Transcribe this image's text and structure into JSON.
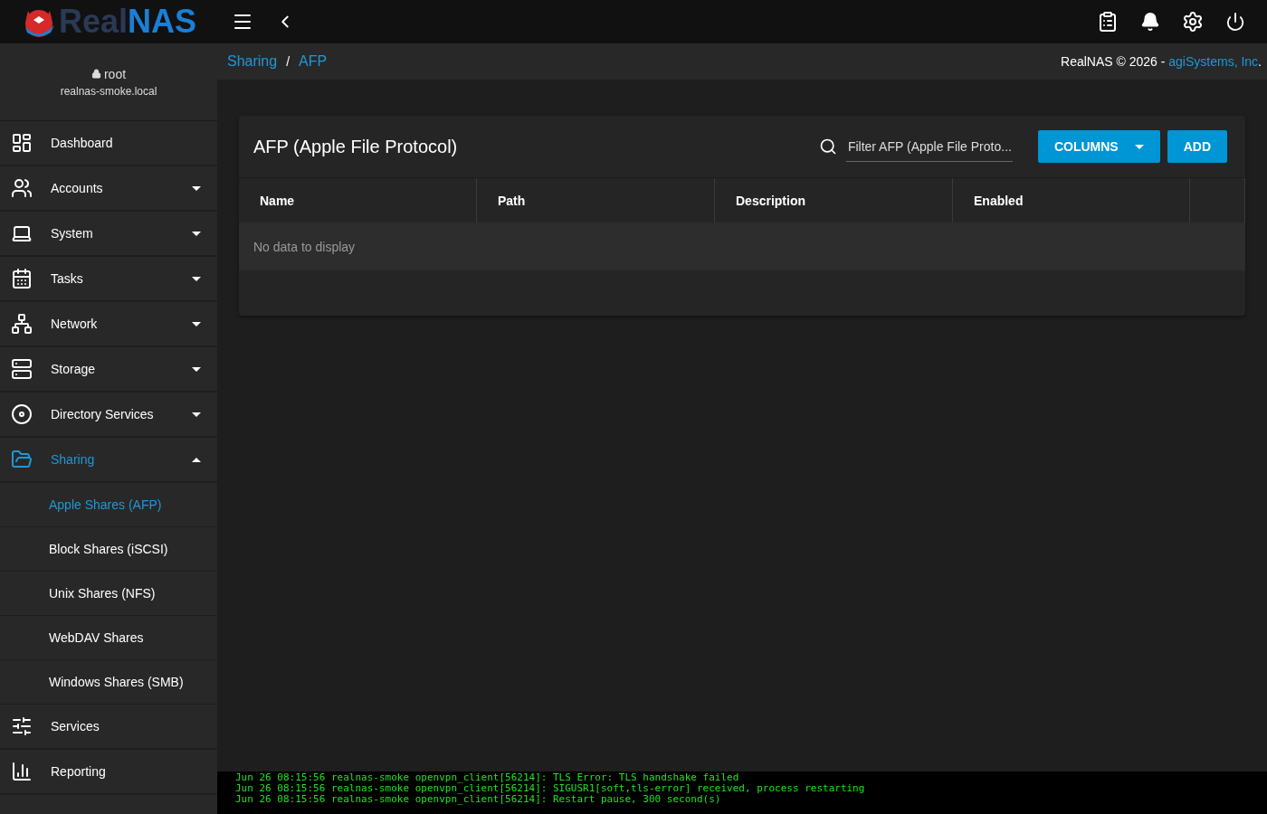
{
  "topbar": {
    "logo_dark": "Real",
    "logo_blue": "NAS"
  },
  "user": {
    "name": "root",
    "host": "realnas-smoke.local"
  },
  "breadcrumb": [
    {
      "label": "Sharing"
    },
    {
      "label": "AFP"
    }
  ],
  "breadcrumb_separator": "/",
  "copyright": {
    "text": "RealNAS © 2026 - ",
    "link": "agiSystems, Inc",
    "end": "."
  },
  "sidebar": [
    {
      "kind": "item",
      "label": "Dashboard",
      "selected": false
    },
    {
      "kind": "group",
      "label": "Accounts",
      "selected": false,
      "expanded": false
    },
    {
      "kind": "group",
      "label": "System",
      "selected": false,
      "expanded": false
    },
    {
      "kind": "group",
      "label": "Tasks",
      "selected": false,
      "expanded": false
    },
    {
      "kind": "group",
      "label": "Network",
      "selected": false,
      "expanded": false
    },
    {
      "kind": "group",
      "label": "Storage",
      "selected": false,
      "expanded": false
    },
    {
      "kind": "group",
      "label": "Directory Services",
      "selected": false,
      "expanded": false
    },
    {
      "kind": "group",
      "label": "Sharing",
      "selected": true,
      "expanded": true,
      "children": [
        {
          "label": "Apple Shares (AFP)",
          "selected": true
        },
        {
          "label": "Block Shares (iSCSI)",
          "selected": false
        },
        {
          "label": "Unix Shares (NFS)",
          "selected": false
        },
        {
          "label": "WebDAV Shares",
          "selected": false
        },
        {
          "label": "Windows Shares (SMB)",
          "selected": false
        }
      ]
    },
    {
      "kind": "item",
      "label": "Services",
      "selected": false
    },
    {
      "kind": "item",
      "label": "Reporting",
      "selected": false
    }
  ],
  "card": {
    "title": "AFP (Apple File Protocol)",
    "filter": {
      "placeholder": "Filter AFP (Apple File Proto..."
    },
    "buttons": [
      {
        "label": "COLUMNS",
        "kind": "dropdown"
      },
      {
        "label": "ADD",
        "kind": "plain"
      }
    ],
    "columns": [
      "Name",
      "Path",
      "Description",
      "Enabled"
    ],
    "empty": "No data to display"
  },
  "console": [
    "Jun 26 08:15:56 realnas-smoke openvpn_client[56214]: TLS Error: TLS handshake failed",
    "Jun 26 08:15:56 realnas-smoke openvpn_client[56214]: SIGUSR1[soft,tls-error] received, process restarting",
    "Jun 26 08:15:56 realnas-smoke openvpn_client[56214]: Restart pause, 300 second(s)"
  ]
}
